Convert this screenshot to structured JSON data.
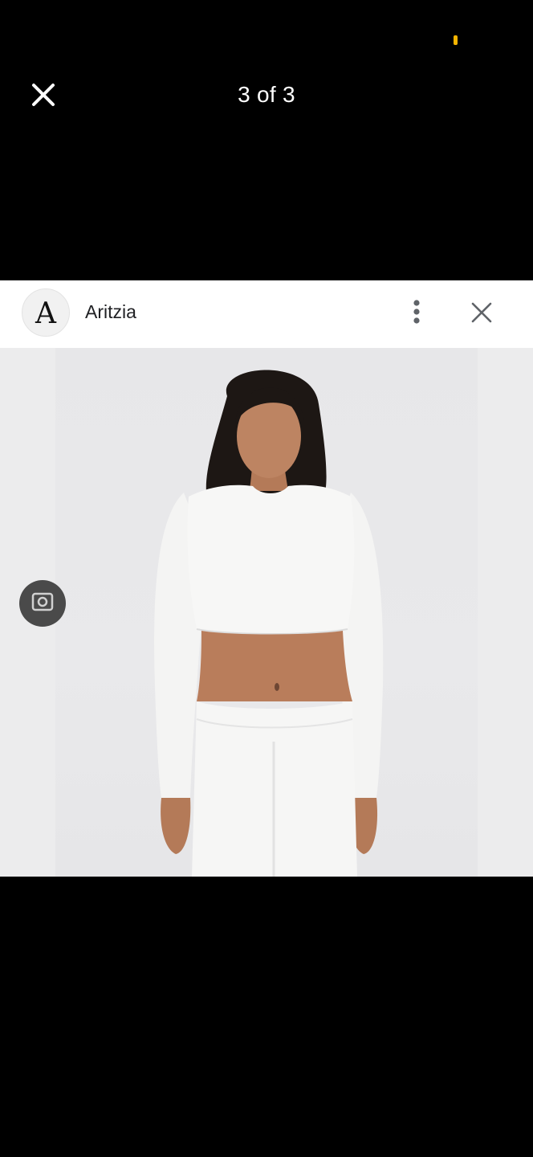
{
  "viewer": {
    "counter": "3 of 3",
    "status_indicator_color": "#f5b400",
    "close_icon": "close-icon"
  },
  "card": {
    "brand": {
      "name": "Aritzia",
      "logo_letter": "A",
      "logo_icon": "brand-logo-icon"
    },
    "more_icon": "more-vert-icon",
    "close_icon": "close-icon",
    "image": {
      "subject": "model wearing white cropped long-sleeve top and white leggings",
      "background_color": "#e8e8ea"
    },
    "lens_icon": "visual-search-icon"
  }
}
